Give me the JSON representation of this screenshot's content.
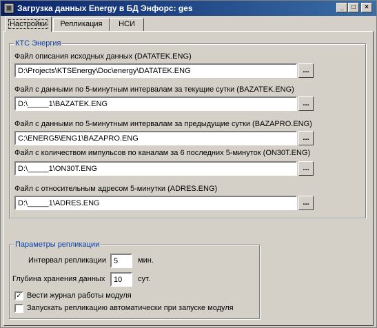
{
  "window": {
    "title": "Загрузка данных Energy в БД Энфорс: ges",
    "min_glyph": "_",
    "max_glyph": "□",
    "close_glyph": "×"
  },
  "tabs": [
    {
      "label": "Настройки",
      "active": true
    },
    {
      "label": "Репликация",
      "active": false
    },
    {
      "label": "НСИ",
      "active": false
    }
  ],
  "kts": {
    "title": "КТС Энергия",
    "browse_label": "...",
    "files": [
      {
        "label": "Файл описания исходных данных (DATATEK.ENG)",
        "value": "D:\\Projects\\KTSEnergy\\Doc\\energy\\DATATEK.ENG"
      },
      {
        "label": "Файл с данными по 5-минутным интервалам за текущие сутки (BAZATEK.ENG)",
        "value": "D:\\_____1\\BAZATEK.ENG"
      },
      {
        "label": "Файл с данными по 5-минутным интервалам за предыдущие сутки (BAZAPRO.ENG)",
        "value": "C:\\ENERG5\\ENG1\\BAZAPRO.ENG"
      },
      {
        "label": "Файл с количеством импульсов по каналам за 6 последних 5-минуток (ON30T.ENG)",
        "value": "D:\\_____1\\ON30T.ENG"
      },
      {
        "label": "Файл с относительным адресом 5-минутки (ADRES.ENG)",
        "value": "D:\\_____1\\ADRES.ENG"
      }
    ]
  },
  "replication": {
    "title": "Параметры репликации",
    "interval_label": "Интервал репликации",
    "interval_value": "5",
    "interval_unit": "мин.",
    "depth_label": "Глубина хранения данных",
    "depth_value": "10",
    "depth_unit": "сут.",
    "log_label": "Вести журнал работы модуля",
    "log_checked": true,
    "log_glyph": "✓",
    "autostart_label": "Запускать репликацию автоматически при запуске модуля",
    "autostart_checked": false
  }
}
